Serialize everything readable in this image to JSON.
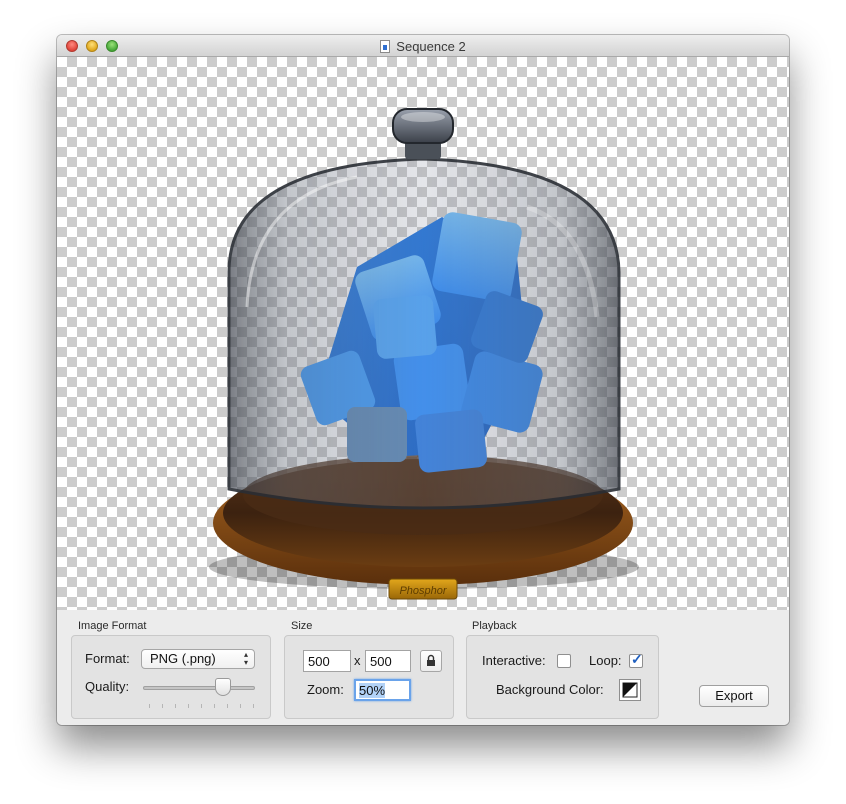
{
  "window": {
    "title": "Sequence 2"
  },
  "canvas": {
    "plaque_text": "Phosphor",
    "accent_color": "#1e90ff"
  },
  "image_format": {
    "group_title": "Image Format",
    "format_label": "Format:",
    "format_value": "PNG (.png)",
    "quality_label": "Quality:",
    "quality_level": 0.75
  },
  "size": {
    "group_title": "Size",
    "width_value": "500",
    "times_symbol": "x",
    "height_value": "500",
    "zoom_label": "Zoom:",
    "zoom_value": "50%"
  },
  "playback": {
    "group_title": "Playback",
    "interactive_label": "Interactive:",
    "interactive_checked": false,
    "loop_label": "Loop:",
    "loop_checked": true,
    "background_color_label": "Background Color:"
  },
  "export_button": "Export"
}
